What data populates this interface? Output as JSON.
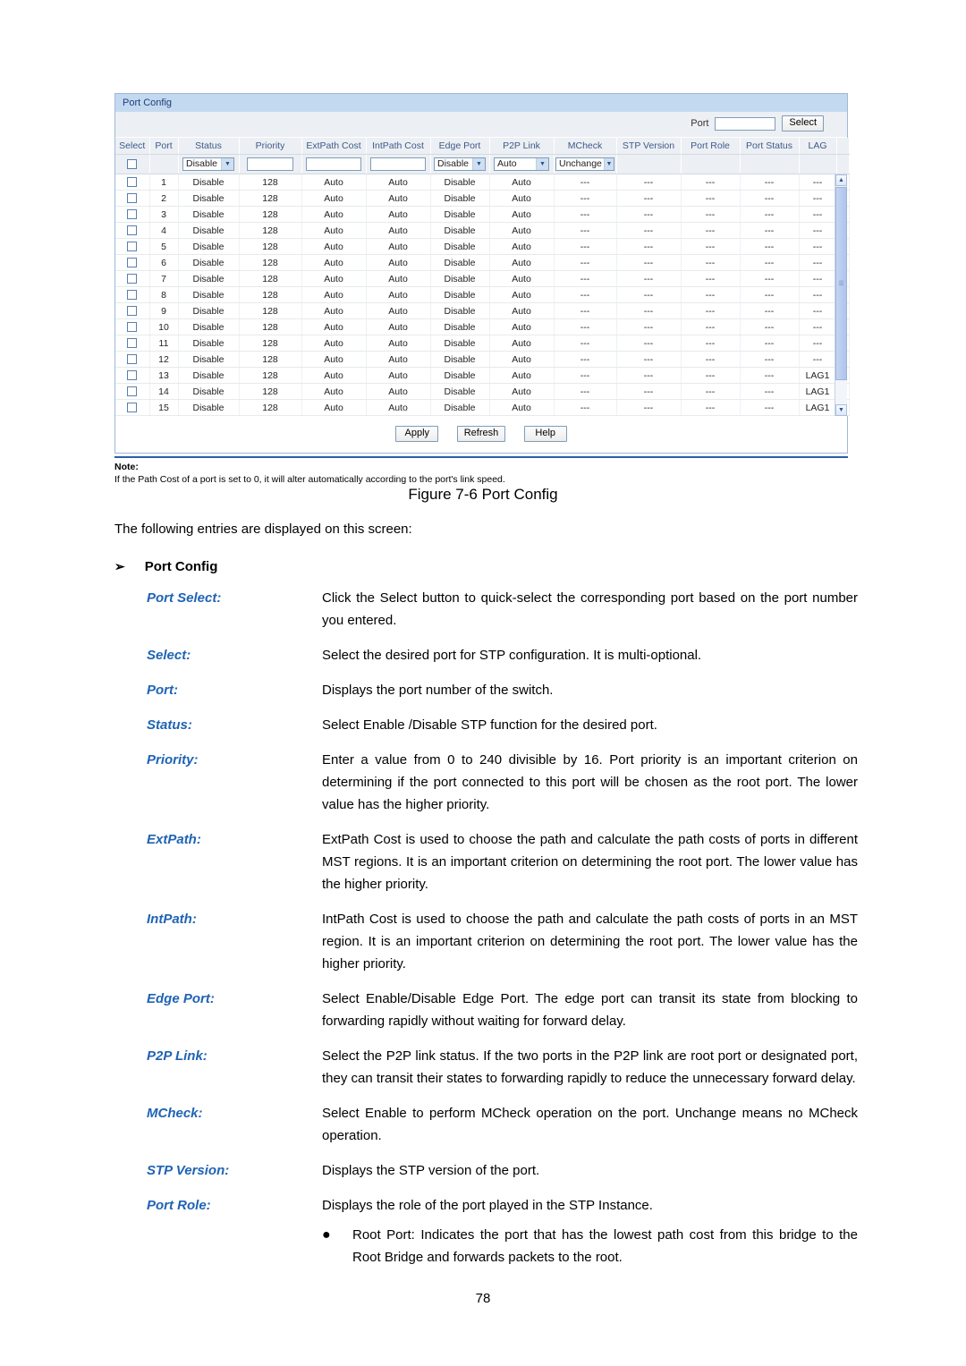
{
  "figure": {
    "panel_title": "Port Config",
    "search": {
      "label": "Port",
      "value": "",
      "placeholder": "",
      "select_button": "Select"
    },
    "columns": [
      "Select",
      "Port",
      "Status",
      "Priority",
      "ExtPath Cost",
      "IntPath Cost",
      "Edge Port",
      "P2P Link",
      "MCheck",
      "STP Version",
      "Port Role",
      "Port Status",
      "LAG"
    ],
    "filter_row": {
      "status": "Disable",
      "priority": "",
      "extpath_cost": "",
      "intpath_cost": "",
      "edge_port": "Disable",
      "p2p_link": "Auto",
      "mcheck": "Unchange"
    },
    "rows": [
      {
        "port": "1",
        "status": "Disable",
        "priority": "128",
        "extpath": "Auto",
        "intpath": "Auto",
        "edge": "Disable",
        "p2p": "Auto",
        "mcheck": "---",
        "stp_version": "---",
        "port_role": "---",
        "port_status": "---",
        "lag": "---"
      },
      {
        "port": "2",
        "status": "Disable",
        "priority": "128",
        "extpath": "Auto",
        "intpath": "Auto",
        "edge": "Disable",
        "p2p": "Auto",
        "mcheck": "---",
        "stp_version": "---",
        "port_role": "---",
        "port_status": "---",
        "lag": "---"
      },
      {
        "port": "3",
        "status": "Disable",
        "priority": "128",
        "extpath": "Auto",
        "intpath": "Auto",
        "edge": "Disable",
        "p2p": "Auto",
        "mcheck": "---",
        "stp_version": "---",
        "port_role": "---",
        "port_status": "---",
        "lag": "---"
      },
      {
        "port": "4",
        "status": "Disable",
        "priority": "128",
        "extpath": "Auto",
        "intpath": "Auto",
        "edge": "Disable",
        "p2p": "Auto",
        "mcheck": "---",
        "stp_version": "---",
        "port_role": "---",
        "port_status": "---",
        "lag": "---"
      },
      {
        "port": "5",
        "status": "Disable",
        "priority": "128",
        "extpath": "Auto",
        "intpath": "Auto",
        "edge": "Disable",
        "p2p": "Auto",
        "mcheck": "---",
        "stp_version": "---",
        "port_role": "---",
        "port_status": "---",
        "lag": "---"
      },
      {
        "port": "6",
        "status": "Disable",
        "priority": "128",
        "extpath": "Auto",
        "intpath": "Auto",
        "edge": "Disable",
        "p2p": "Auto",
        "mcheck": "---",
        "stp_version": "---",
        "port_role": "---",
        "port_status": "---",
        "lag": "---"
      },
      {
        "port": "7",
        "status": "Disable",
        "priority": "128",
        "extpath": "Auto",
        "intpath": "Auto",
        "edge": "Disable",
        "p2p": "Auto",
        "mcheck": "---",
        "stp_version": "---",
        "port_role": "---",
        "port_status": "---",
        "lag": "---"
      },
      {
        "port": "8",
        "status": "Disable",
        "priority": "128",
        "extpath": "Auto",
        "intpath": "Auto",
        "edge": "Disable",
        "p2p": "Auto",
        "mcheck": "---",
        "stp_version": "---",
        "port_role": "---",
        "port_status": "---",
        "lag": "---"
      },
      {
        "port": "9",
        "status": "Disable",
        "priority": "128",
        "extpath": "Auto",
        "intpath": "Auto",
        "edge": "Disable",
        "p2p": "Auto",
        "mcheck": "---",
        "stp_version": "---",
        "port_role": "---",
        "port_status": "---",
        "lag": "---"
      },
      {
        "port": "10",
        "status": "Disable",
        "priority": "128",
        "extpath": "Auto",
        "intpath": "Auto",
        "edge": "Disable",
        "p2p": "Auto",
        "mcheck": "---",
        "stp_version": "---",
        "port_role": "---",
        "port_status": "---",
        "lag": "---"
      },
      {
        "port": "11",
        "status": "Disable",
        "priority": "128",
        "extpath": "Auto",
        "intpath": "Auto",
        "edge": "Disable",
        "p2p": "Auto",
        "mcheck": "---",
        "stp_version": "---",
        "port_role": "---",
        "port_status": "---",
        "lag": "---"
      },
      {
        "port": "12",
        "status": "Disable",
        "priority": "128",
        "extpath": "Auto",
        "intpath": "Auto",
        "edge": "Disable",
        "p2p": "Auto",
        "mcheck": "---",
        "stp_version": "---",
        "port_role": "---",
        "port_status": "---",
        "lag": "---"
      },
      {
        "port": "13",
        "status": "Disable",
        "priority": "128",
        "extpath": "Auto",
        "intpath": "Auto",
        "edge": "Disable",
        "p2p": "Auto",
        "mcheck": "---",
        "stp_version": "---",
        "port_role": "---",
        "port_status": "---",
        "lag": "LAG1"
      },
      {
        "port": "14",
        "status": "Disable",
        "priority": "128",
        "extpath": "Auto",
        "intpath": "Auto",
        "edge": "Disable",
        "p2p": "Auto",
        "mcheck": "---",
        "stp_version": "---",
        "port_role": "---",
        "port_status": "---",
        "lag": "LAG1"
      },
      {
        "port": "15",
        "status": "Disable",
        "priority": "128",
        "extpath": "Auto",
        "intpath": "Auto",
        "edge": "Disable",
        "p2p": "Auto",
        "mcheck": "---",
        "stp_version": "---",
        "port_role": "---",
        "port_status": "---",
        "lag": "LAG1"
      }
    ],
    "buttons": {
      "apply": "Apply",
      "refresh": "Refresh",
      "help": "Help"
    },
    "note": {
      "title": "Note:",
      "text": "If the Path Cost of a port is set to 0, it will alter automatically according to the port's link speed."
    },
    "caption": "Figure 7-6 Port Config"
  },
  "document": {
    "lead": "The following entries are displayed on this screen:",
    "section_marker": "➢",
    "section_title": "Port Config",
    "entries": [
      {
        "term": "Port Select:",
        "desc": "Click the Select button to quick-select the corresponding port based on the port number you entered."
      },
      {
        "term": "Select:",
        "desc": "Select the desired port for STP configuration. It is multi-optional."
      },
      {
        "term": "Port:",
        "desc": "Displays the port number of the switch."
      },
      {
        "term": "Status:",
        "desc": "Select Enable /Disable STP function for the desired port."
      },
      {
        "term": "Priority:",
        "desc": "Enter a value from 0 to 240 divisible by 16. Port priority is an important criterion on determining if the port connected to this port will be chosen as the root port. The lower value has the higher priority."
      },
      {
        "term": "ExtPath:",
        "desc": "ExtPath Cost is used to choose the path and calculate the path costs of ports in different MST regions. It is an important criterion on determining the root port. The lower value has the higher priority."
      },
      {
        "term": "IntPath:",
        "desc": "IntPath Cost is used to choose the path and calculate the path costs of ports in an MST region. It is an important criterion on determining the root port. The lower value has the higher priority."
      },
      {
        "term": "Edge Port:",
        "desc": "Select Enable/Disable Edge Port. The edge port can transit its state from blocking to forwarding rapidly without waiting for forward delay."
      },
      {
        "term": "P2P Link:",
        "desc": "Select the P2P link status. If the two ports in the P2P link are root port or designated port, they can transit their states to forwarding rapidly to reduce the unnecessary forward delay."
      },
      {
        "term": "MCheck:",
        "desc": "Select Enable to perform MCheck operation on the port. Unchange means no MCheck operation."
      },
      {
        "term": "STP Version:",
        "desc": "Displays the STP version of the port."
      },
      {
        "term": "Port Role:",
        "desc": "Displays the role of the port played in the STP Instance.",
        "bullet_marker": "●",
        "bullet": "Root Port: Indicates the port that has the lowest path cost from this bridge to the Root Bridge and forwards packets to the root."
      }
    ]
  },
  "page_number": "78",
  "colors": {
    "panel_title_bg": "#c3d9f0",
    "panel_title_text": "#1f3d7a",
    "header_text": "#3d5a8a",
    "term_blue": "#1f63b4",
    "note_rule": "#2b5ea8"
  }
}
